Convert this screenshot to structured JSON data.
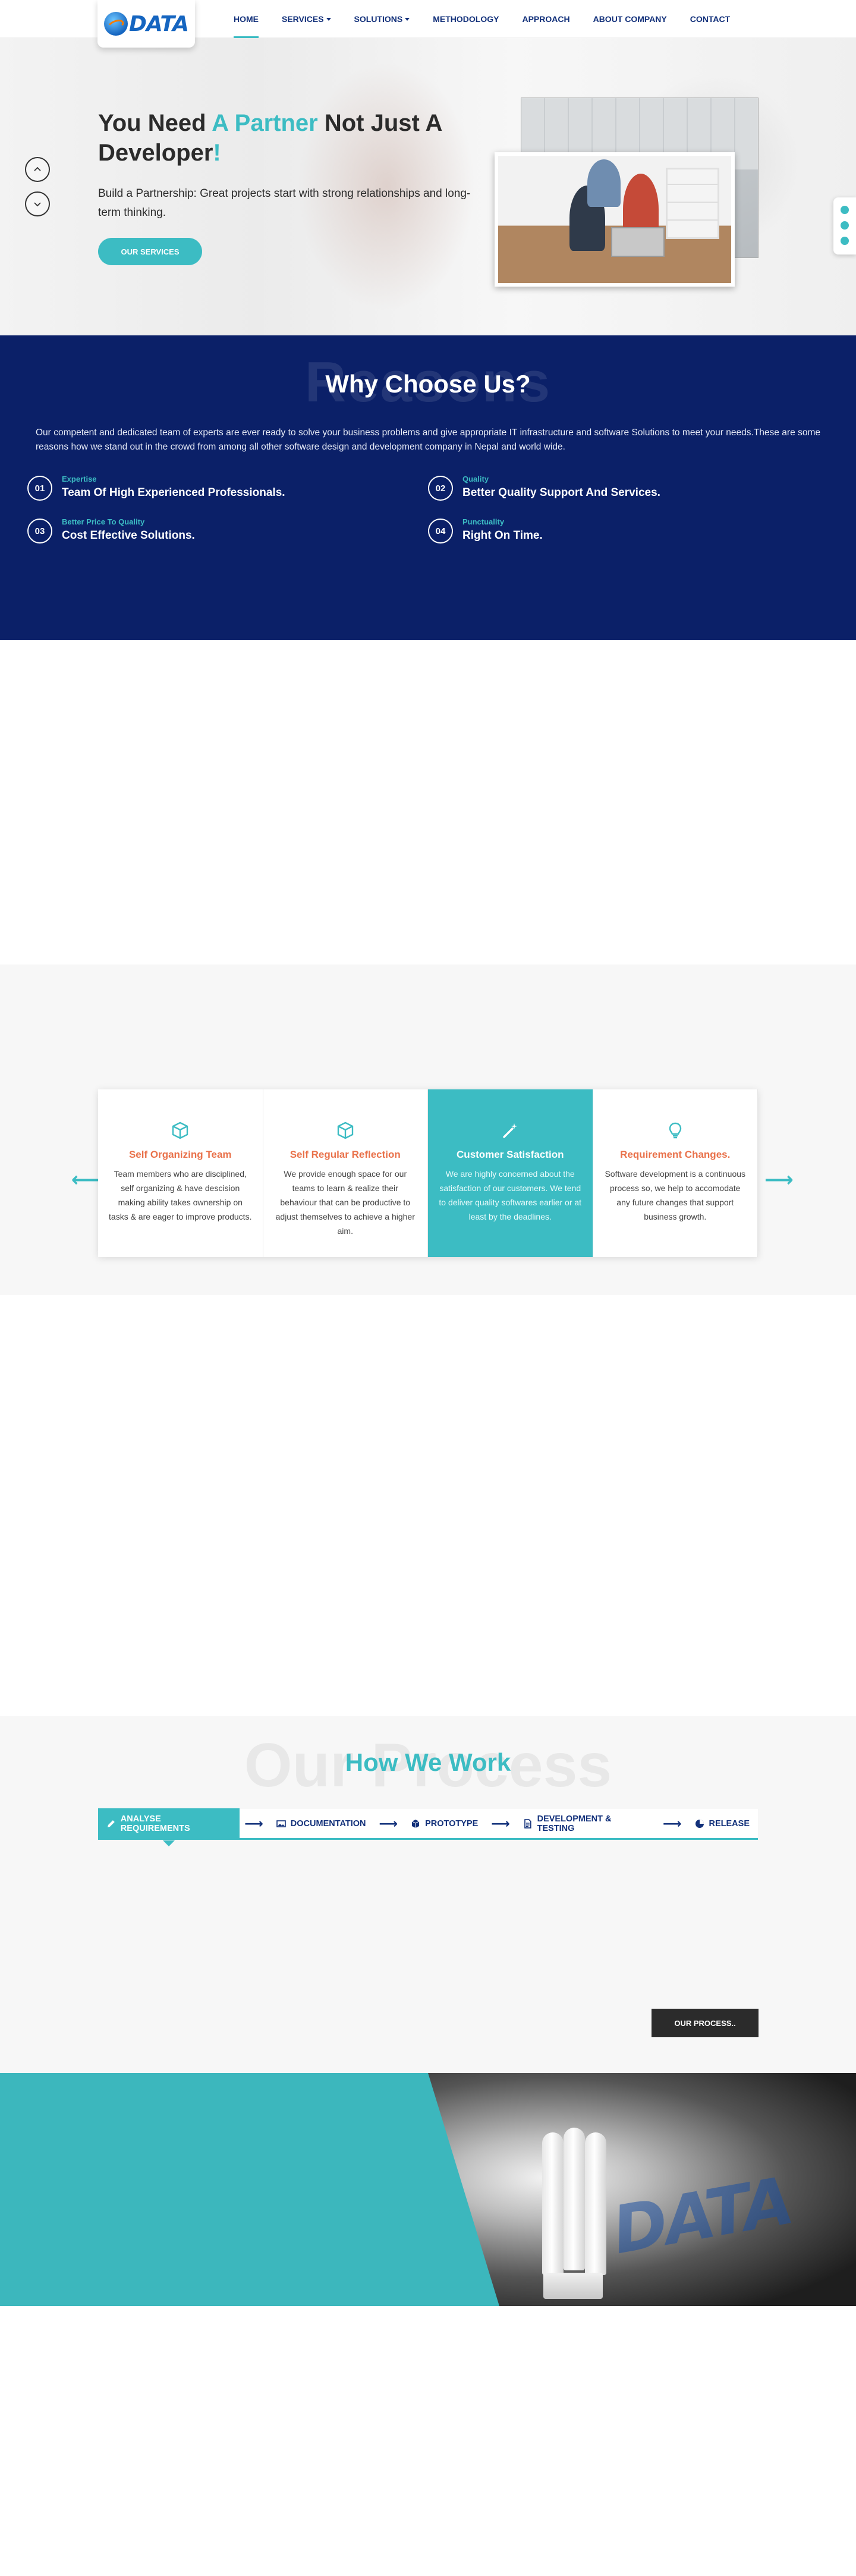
{
  "brand": {
    "logo_text": "DATA"
  },
  "nav": {
    "items": [
      {
        "label": "HOME",
        "active": true,
        "dropdown": false
      },
      {
        "label": "SERVICES",
        "active": false,
        "dropdown": true
      },
      {
        "label": "SOLUTIONS",
        "active": false,
        "dropdown": true
      },
      {
        "label": "METHODOLOGY",
        "active": false,
        "dropdown": false
      },
      {
        "label": "APPROACH",
        "active": false,
        "dropdown": false
      },
      {
        "label": "ABOUT COMPANY",
        "active": false,
        "dropdown": false
      },
      {
        "label": "CONTACT",
        "active": false,
        "dropdown": false
      }
    ]
  },
  "hero": {
    "title_part1": "You Need ",
    "title_accent": "A Partner",
    "title_part2": " Not Just A Developer",
    "title_bang": "!",
    "subtitle": "Build a Partnership: Great projects start with strong relationships and long-term thinking.",
    "button_label": "OUR SERVICES",
    "prev_icon": "chevron-up-icon",
    "next_icon": "chevron-down-icon"
  },
  "why": {
    "ghost": "Reasons",
    "title": "Why Choose Us?",
    "description": "Our competent and dedicated team of experts are ever ready to solve your business problems and give appropriate IT infrastructure and software Solutions to meet your needs.These are some reasons how we stand out in the crowd from among all other software design and development company in Nepal and world wide.",
    "reasons": [
      {
        "num": "01",
        "kicker": "Expertise",
        "title": "Team Of High Experienced Professionals."
      },
      {
        "num": "02",
        "kicker": "Quality",
        "title": "Better Quality Support And Services."
      },
      {
        "num": "03",
        "kicker": "Better Price To Quality",
        "title": "Cost Effective Solutions."
      },
      {
        "num": "04",
        "kicker": "Punctuality",
        "title": "Right On Time."
      }
    ]
  },
  "values": {
    "cards": [
      {
        "icon": "cube-icon",
        "title": "Self Organizing Team",
        "text": "Team members who are disciplined, self organizing & have descision making ability takes ownership on tasks & are eager to improve products.",
        "active": false
      },
      {
        "icon": "cube-icon",
        "title": "Self Regular Reflection",
        "text": "We provide enough space for our teams to learn & realize their behaviour that can be productive to adjust themselves to achieve a higher aim.",
        "active": false
      },
      {
        "icon": "magic-wand-icon",
        "title": "Customer Satisfaction",
        "text": "We are highly concerned about the satisfaction of our customers. We tend to deliver quality softwares earlier or at least by the deadlines.",
        "active": true
      },
      {
        "icon": "lightbulb-icon",
        "title": "Requirement Changes.",
        "text": "Software development is a continuous process so, we help to accomodate any future changes that support business growth.",
        "active": false
      }
    ]
  },
  "process": {
    "ghost": "Our Process",
    "title": "How We Work",
    "tabs": [
      {
        "icon": "pencil-icon",
        "label": "ANALYSE REQUIREMENTS",
        "active": true
      },
      {
        "icon": "image-icon",
        "label": "DOCUMENTATION",
        "active": false
      },
      {
        "icon": "cube-icon",
        "label": "PROTOTYPE",
        "active": false
      },
      {
        "icon": "file-icon",
        "label": "DEVELOPMENT & TESTING",
        "active": false
      },
      {
        "icon": "pie-chart-icon",
        "label": "RELEASE",
        "active": false
      }
    ],
    "button_label": "OUR PROCESS.."
  },
  "banner": {
    "logo_text": "DATA"
  },
  "colors": {
    "accent": "#3cbcc3",
    "navy": "#0b2068",
    "orange": "#e9714a",
    "dark_button": "#2b2b2b"
  }
}
